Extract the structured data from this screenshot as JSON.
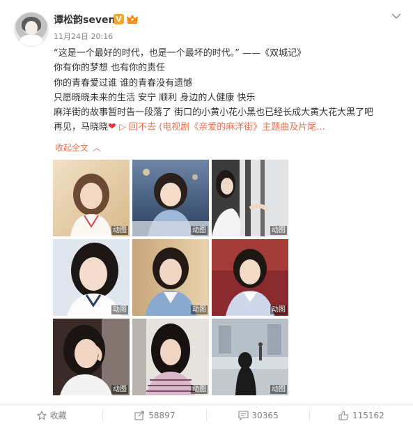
{
  "post": {
    "username": "谭松韵seven",
    "verified_badge": "V",
    "crown_badge": "crown-icon",
    "timestamp": "11月24日 20:16",
    "lines": [
      "“这是一个最好的时代，也是一个最坏的时代。” ——《双城记》",
      "你有你的梦想 也有你的责任",
      "你的青春爱过谁 谁的青春没有遗憾",
      "只愿晓晓未来的生活 安宁 顺利 身边的人健康 快乐",
      "麻洋街的故事暂时告一段落了 街口的小黄小花小黑也已经长成大黄大花大黑了吧"
    ],
    "last_line_prefix": "再见，马晓晓",
    "heart": "❤",
    "video_link": "▷ 回不去 (电视剧《亲爱的麻洋街》主题曲及片尾...",
    "collapse_label": "收起全文",
    "collapse_caret": "︿"
  },
  "images": [
    {
      "badge": "动图"
    },
    {
      "badge": "动图"
    },
    {
      "badge": "动图"
    },
    {
      "badge": "动图"
    },
    {
      "badge": "动图"
    },
    {
      "badge": "动图"
    },
    {
      "badge": "动图"
    },
    {
      "badge": "动图"
    },
    {
      "badge": "动图"
    }
  ],
  "actions": {
    "favorite_label": "收藏",
    "repost_count": "58897",
    "comment_count": "30365",
    "like_count": "115162"
  },
  "colors": {
    "accent": "#eb7350",
    "heart": "#e8343c",
    "muted": "#808080"
  }
}
